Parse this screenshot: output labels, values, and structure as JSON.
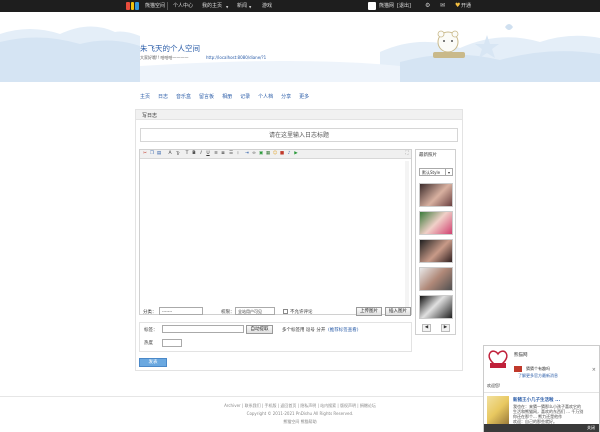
{
  "colors": {
    "topbar": "#1e1e1e",
    "link": "#2a5ca8",
    "publish": "#6aa8e0"
  },
  "topbar": {
    "site": "熊猫空间",
    "items": [
      "个人中心",
      "我的主页",
      "新闻",
      "游戏"
    ],
    "user": "熊猫网",
    "logout": "[退出]",
    "follow": "开通"
  },
  "header": {
    "title": "朱飞天的个人空间",
    "subtitle": "大家好哦!! 哈哈哈————",
    "url": "http://localhost:8080/diane/?1"
  },
  "nav": [
    "主页",
    "日志",
    "音乐盒",
    "留言板",
    "相册",
    "记录",
    "个人档",
    "分享",
    "更多"
  ],
  "panel": {
    "heading": "写日志",
    "title_placeholder": "请在这里输入日志标题",
    "right_title": "最新照片",
    "style_select": "默认Style",
    "category_label": "分类：",
    "category_value": "-------",
    "privacy_label": "权限：",
    "privacy_value": "全站用户可见",
    "allow_comment": "不允许评论",
    "upload_btn": "上传图片",
    "insert_btn": "插入图片",
    "tag_label": "标签：",
    "auto_tag_btn": "自动提取",
    "tag_hint": "多个标签用 逗号 分开",
    "tag_link": "(推荐标签查看)",
    "mood_label": "热度",
    "publish": "发表"
  },
  "footer": {
    "links": "Archiver | 联系我们 | 手机版 | 返回首页 | 隐私声明 | 站内搜索 | 版权声明 | 捐赠论坛",
    "copyright": "Copyright © 2011-2021 PnDishu All Rights Reserved.",
    "credit": "熊猫空间 熊猫帮助"
  },
  "popup": {
    "sender": "熊猫网",
    "msg1": "猜猜个有趣吗",
    "msg2": "了解更多官方最新消息",
    "welcome": "欢迎您!",
    "name2": "新猪王小几子生活啦 ...",
    "line1": "我也在：来猜一猜那么小孩子喜欢它的",
    "line2": "生活和熊猫网，喜欢的东西们 ... 千万别",
    "line3": "你还在那个... 熊力还是他作",
    "line4": "欢迎：自己的那些就好。",
    "close": "关闭"
  }
}
